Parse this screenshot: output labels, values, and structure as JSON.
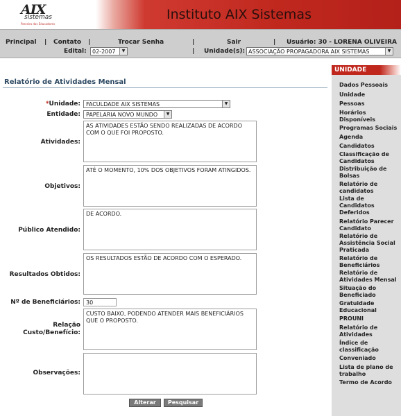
{
  "header": {
    "logo_mark": "AIX",
    "logo_sub": "sistemas",
    "logo_tagline": "Parceira dos Educadores",
    "title": "Instituto AIX Sistemas",
    "brand_color": "#c0281e"
  },
  "nav": {
    "principal": "Principal",
    "contato": "Contato",
    "trocar_senha": "Trocar Senha",
    "sair": "Sair",
    "usuario": "Usuário: 30 - LORENA OLIVEIRA",
    "edital_label": "Edital:",
    "edital_value": "02-2007",
    "unidades_label": "Unidade(s):",
    "unidades_value": "ASSOCIAÇÃO PROPAGADORA AIX SISTEMAS",
    "separator": "|"
  },
  "form": {
    "title": "Relatório de Atividades Mensal",
    "unidade_label": "Unidade:",
    "unidade_value": "FACULDADE AIX SISTEMAS",
    "entidade_label": "Entidade:",
    "entidade_value": "PAPELARIA NOVO MUNDO",
    "atividades_label": "Atividades:",
    "atividades_value": "AS ATIVIDADES ESTÃO SENDO REALIZADAS DE ACORDO COM O QUE FOI PROPOSTO.",
    "objetivos_label": "Objetivos:",
    "objetivos_value": "ATÉ O MOMENTO, 10% DOS OBJETIVOS FORAM ATINGIDOS.",
    "publico_label": "Público Atendido:",
    "publico_value": "DE ACORDO.",
    "resultados_label": "Resultados Obtidos:",
    "resultados_value": "OS RESULTADOS ESTÃO DE ACORDO COM O ESPERADO.",
    "beneficiarios_label": "Nº de Beneficiários:",
    "beneficiarios_value": "30",
    "relacao_label_1": "Relação",
    "relacao_label_2": "Custo/Benefício:",
    "relacao_value": "CUSTO BAIXO, PODENDO ATENDER MAIS BENEFICIÁRIOS QUE O PROPOSTO.",
    "observacoes_label": "Observações:",
    "observacoes_value": "",
    "alterar_label": "Alterar",
    "pesquisar_label": "Pesquisar"
  },
  "sidebar": {
    "title": "UNIDADE",
    "items": [
      "Dados Pessoais",
      "Unidade",
      "Pessoas",
      "Horários Disponíveis",
      "Programas Sociais",
      "Agenda",
      "Candidatos",
      "Classificação de Candidatos",
      "Distribuição de Bolsas",
      "Relatório de candidatos",
      "Lista de Candidatos Deferidos",
      "Relatório Parecer Candidato",
      "Relatório de Assistência Social Praticada",
      "Relatório de Beneficiários",
      "Relatório de Atividades Mensal",
      "Situação do Beneficiado",
      "Gratuidade Educacional",
      "PROUNI",
      "Relatório de Atividades",
      "Índice de classificação",
      "Conveniado",
      "Lista de plano de trabalho",
      "Termo de Acordo"
    ]
  }
}
